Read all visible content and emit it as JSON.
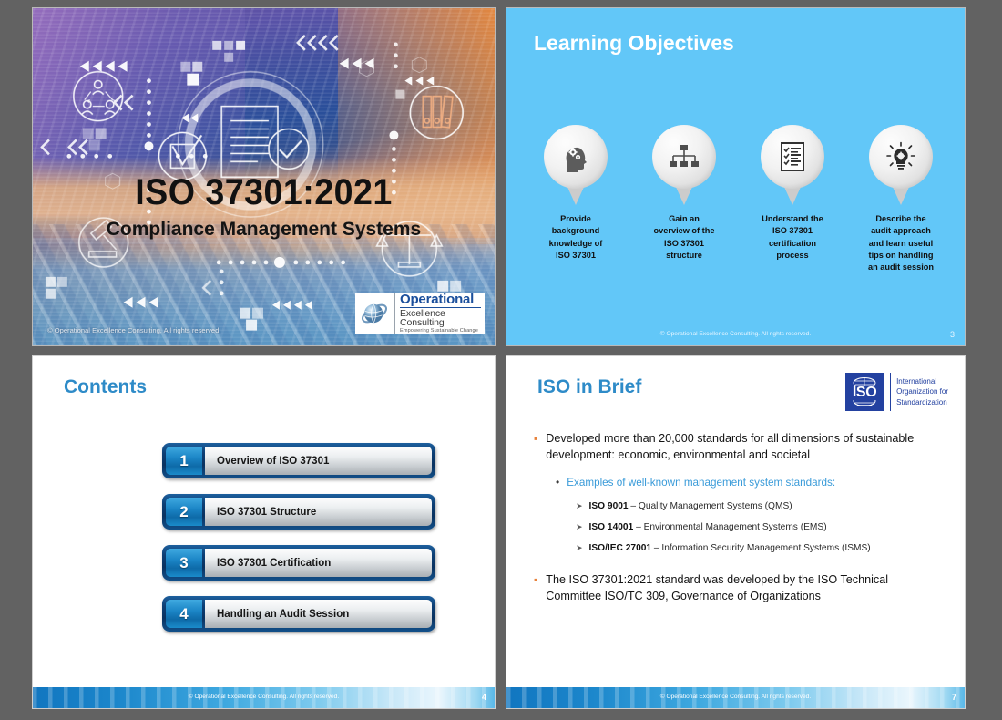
{
  "page": {
    "background_color": "#626262"
  },
  "slides": [
    {
      "id": "title-slide",
      "title_main": "ISO 37301:2021",
      "title_sub": "Compliance Management Systems",
      "copyright": "© Operational Excellence Consulting.  All rights reserved.",
      "logo": {
        "line1": "Operational",
        "line2": "Excellence Consulting",
        "line3": "Empowering Sustainable Change"
      },
      "icons": [
        "network-people-icon",
        "checkbox-tick-icon",
        "document-icon",
        "checkmark-circle-icon",
        "binders-icon",
        "gavel-icon",
        "scales-icon"
      ]
    },
    {
      "id": "learning-objectives-slide",
      "heading": "Learning Objectives",
      "accent_color": "#62c7f8",
      "objectives": [
        {
          "icon": "head-gears-icon",
          "label": "Provide\nbackground\nknowledge of\nISO 37301"
        },
        {
          "icon": "org-chart-icon",
          "label": "Gain an\noverview of the\nISO 37301\nstructure"
        },
        {
          "icon": "checklist-clipboard-icon",
          "label": "Understand the\nISO 37301\ncertification\nprocess"
        },
        {
          "icon": "lightbulb-gear-icon",
          "label": "Describe the\naudit approach\nand learn useful\ntips on handling\nan audit session"
        }
      ],
      "footer": "© Operational Excellence Consulting.  All rights reserved.",
      "slide_number": "3"
    },
    {
      "id": "contents-slide",
      "heading": "Contents",
      "heading_color": "#2e8bc8",
      "items": [
        {
          "number": "1",
          "label": "Overview of ISO 37301"
        },
        {
          "number": "2",
          "label": "ISO 37301 Structure"
        },
        {
          "number": "3",
          "label": "ISO 37301 Certification"
        },
        {
          "number": "4",
          "label": "Handling an Audit Session"
        }
      ],
      "footer": "© Operational Excellence Consulting.  All rights reserved.",
      "slide_number": "4"
    },
    {
      "id": "iso-in-brief-slide",
      "heading": "ISO in Brief",
      "heading_color": "#2e8bc8",
      "logo": {
        "mark": "ISO",
        "line1": "International",
        "line2": "Organization for",
        "line3": "Standardization",
        "color": "#2341a0"
      },
      "bullet1": "Developed more than 20,000 standards for all dimensions of sustainable development: economic, environmental and societal",
      "subbullet": "Examples of well-known management system standards:",
      "standards": [
        {
          "code": "ISO 9001",
          "desc": " – Quality Management Systems (QMS)"
        },
        {
          "code": "ISO 14001",
          "desc": " – Environmental Management Systems (EMS)"
        },
        {
          "code": "ISO/IEC 27001",
          "desc": " – Information Security Management Systems (ISMS)"
        }
      ],
      "bullet2": "The ISO 37301:2021 standard was developed by the ISO Technical Committee ISO/TC 309, Governance of Organizations",
      "footer": "© Operational Excellence Consulting.  All rights reserved.",
      "slide_number": "7"
    }
  ]
}
